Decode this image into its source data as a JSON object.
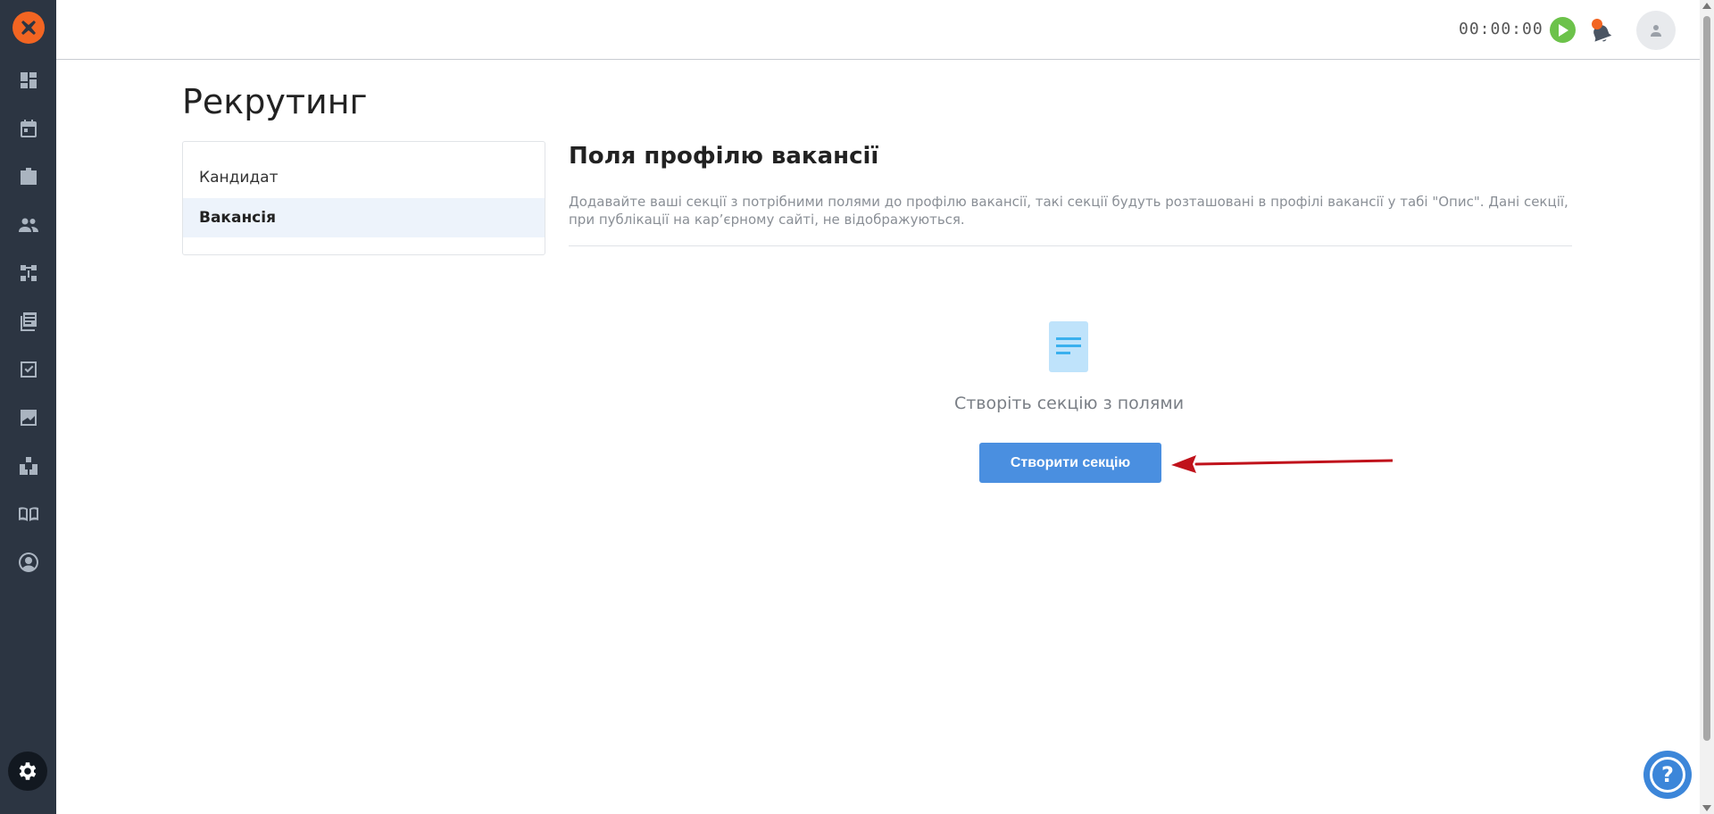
{
  "topbar": {
    "timer": "00:00:00"
  },
  "sidebar": {
    "items": [
      {
        "icon": "dashboard-icon"
      },
      {
        "icon": "calendar-icon"
      },
      {
        "icon": "vacancies-icon"
      },
      {
        "icon": "candidates-icon"
      },
      {
        "icon": "pipeline-icon"
      },
      {
        "icon": "library-icon"
      },
      {
        "icon": "tasks-icon"
      },
      {
        "icon": "reports-icon"
      },
      {
        "icon": "integrations-icon"
      },
      {
        "icon": "knowledge-base-icon"
      },
      {
        "icon": "account-icon"
      }
    ]
  },
  "page": {
    "title": "Рекрутинг"
  },
  "menu": {
    "items": [
      {
        "label": "Кандидат",
        "active": false
      },
      {
        "label": "Вакансія",
        "active": true
      }
    ]
  },
  "content": {
    "title": "Поля профілю вакансії",
    "description": "Додавайте ваші секції з потрібними полями до профілю вакансії, такі секції будуть розташовані в профілі вакансії у табі \"Опис\". Дані секції, при публікації на кар’єрному сайті, не відображуються.",
    "empty_text": "Створіть секцію з полями",
    "create_button": "Створити секцію"
  },
  "help": {
    "label": "?"
  },
  "colors": {
    "sidebar_bg": "#2c3542",
    "brand_orange": "#f26522",
    "primary_blue": "#4a8fe0",
    "play_green": "#6cc24a",
    "annotation_red": "#c0121b"
  }
}
